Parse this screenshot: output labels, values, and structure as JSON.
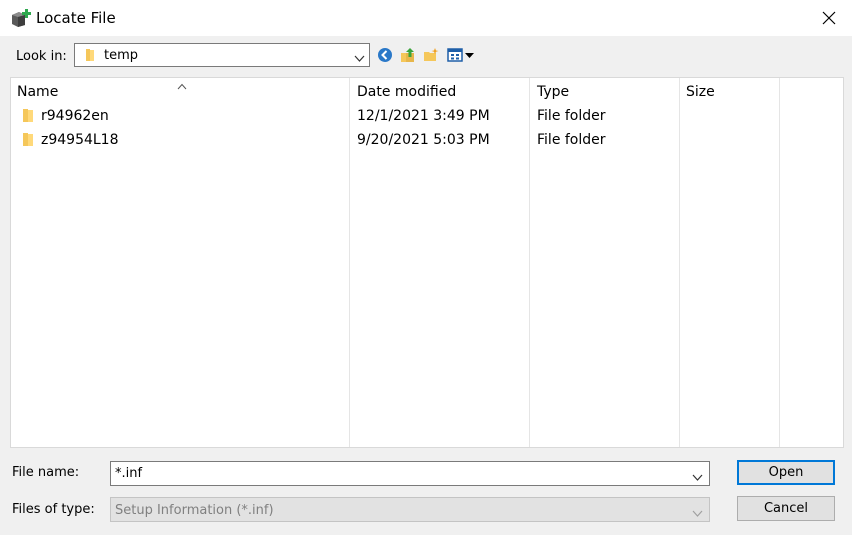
{
  "window": {
    "title": "Locate File"
  },
  "lookin": {
    "label": "Look in:",
    "value": "temp"
  },
  "toolbar": {
    "back": "back-icon",
    "up": "up-folder-icon",
    "new_folder": "new-folder-icon",
    "view_menu": "view-menu-icon"
  },
  "list": {
    "columns": [
      "Name",
      "Date modified",
      "Type",
      "Size"
    ],
    "rows": [
      {
        "name": "r94962en",
        "date": "12/1/2021 3:49 PM",
        "type": "File folder",
        "size": ""
      },
      {
        "name": "z94954L18",
        "date": "9/20/2021 5:03 PM",
        "type": "File folder",
        "size": ""
      }
    ]
  },
  "filename": {
    "label": "File name:",
    "value": "*.inf"
  },
  "filetype": {
    "label": "Files of type:",
    "value": "Setup Information (*.inf)"
  },
  "buttons": {
    "open": "Open",
    "cancel": "Cancel"
  },
  "colors": {
    "accent": "#0078d7",
    "folder": "#f5c75a",
    "disabled_text": "#808080"
  }
}
